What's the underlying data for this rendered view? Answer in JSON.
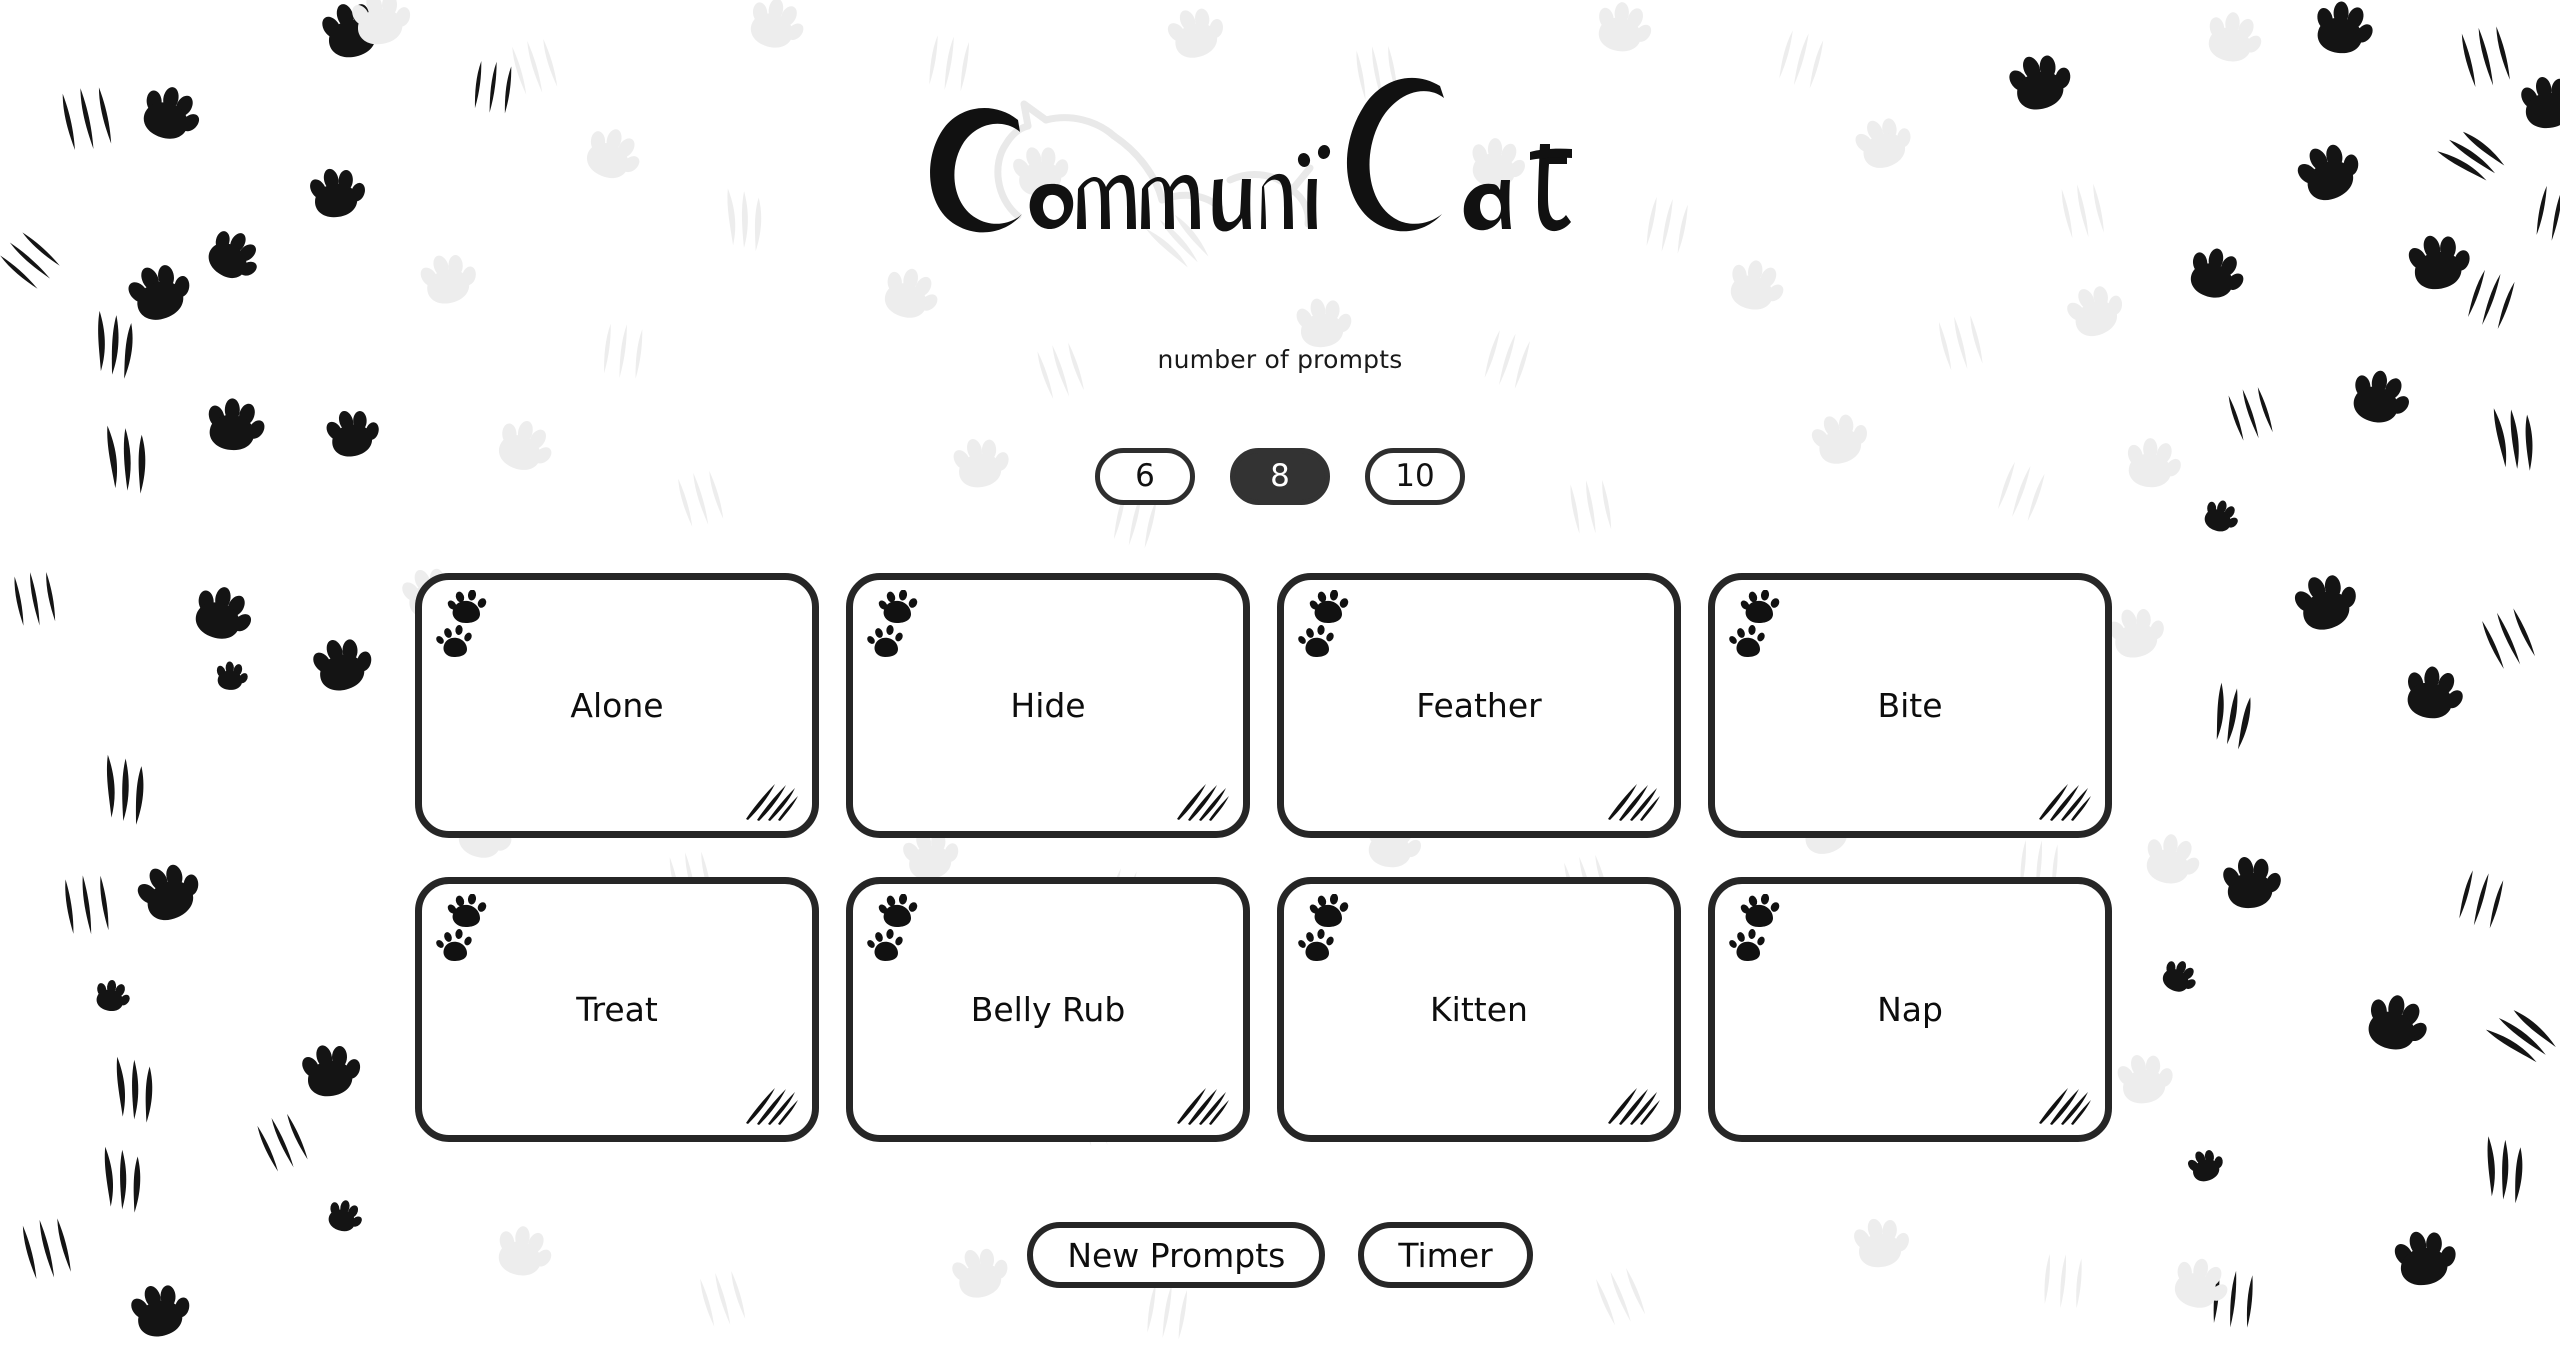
{
  "app": {
    "title": "CommuniCat",
    "background_pattern": "paw-prints-and-claw-scratches"
  },
  "colors": {
    "ink": "#262626",
    "selected_fill": "#333333",
    "selected_text": "#ffffff",
    "page_background": "#ffffff",
    "pattern_dark": "#111111",
    "pattern_faded": "#ededed"
  },
  "settings": {
    "label": "number of prompts",
    "options": [
      {
        "value": "6",
        "selected": false
      },
      {
        "value": "8",
        "selected": true
      },
      {
        "value": "10",
        "selected": false
      }
    ],
    "selected_value": "8"
  },
  "cards": [
    {
      "label": "Alone"
    },
    {
      "label": "Hide"
    },
    {
      "label": "Feather"
    },
    {
      "label": "Bite"
    },
    {
      "label": "Treat"
    },
    {
      "label": "Belly Rub"
    },
    {
      "label": "Kitten"
    },
    {
      "label": "Nap"
    }
  ],
  "card_decor": {
    "top_left_icon": "paw-prints-icon",
    "bottom_right_icon": "claw-scratch-icon"
  },
  "actions": [
    {
      "label": "New Prompts",
      "name": "new-prompts-button"
    },
    {
      "label": "Timer",
      "name": "timer-button"
    }
  ]
}
